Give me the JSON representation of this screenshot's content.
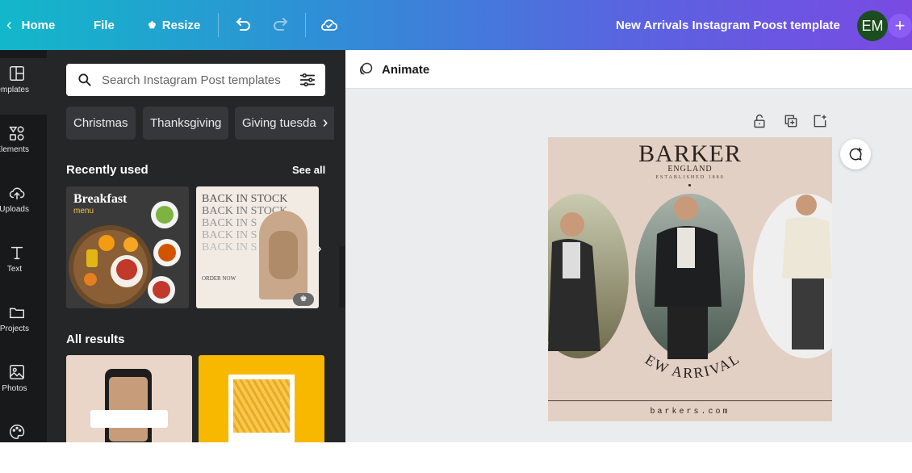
{
  "topbar": {
    "home_label": "Home",
    "file_label": "File",
    "resize_label": "Resize",
    "doc_title": "New Arrivals Instagram Poost template",
    "avatar_initials": "EM",
    "plus_label": "+"
  },
  "rail": {
    "items": [
      {
        "label": "Templates",
        "icon": "templates-icon"
      },
      {
        "label": "Elements",
        "icon": "elements-icon"
      },
      {
        "label": "Uploads",
        "icon": "uploads-icon"
      },
      {
        "label": "Text",
        "icon": "text-icon"
      },
      {
        "label": "Projects",
        "icon": "projects-icon"
      },
      {
        "label": "Photos",
        "icon": "photos-icon"
      },
      {
        "label": "",
        "icon": "palette-icon"
      }
    ]
  },
  "panel": {
    "search_placeholder": "Search Instagram Post templates",
    "chips": [
      "Christmas",
      "Thanksgiving",
      "Giving tuesday"
    ],
    "recently_used_title": "Recently used",
    "see_all_label": "See all",
    "all_results_title": "All results",
    "recent_thumbs": [
      {
        "title": "Breakfast",
        "subtitle": "menu"
      },
      {
        "lines": [
          "BACK IN STOCK",
          "BACK IN STOCK",
          "BACK IN S",
          "BACK IN S",
          "BACK IN S"
        ],
        "cta": "ORDER NOW"
      }
    ]
  },
  "workspace": {
    "animate_label": "Animate",
    "design": {
      "brand": "BARKER",
      "country": "ENGLAND",
      "established": "ESTABLISHED 1880",
      "headline": "NEW ARRIVALS",
      "url": "barkers.com"
    }
  },
  "colors": {
    "rail_bg": "#18191b",
    "panel_bg": "#252627",
    "design_bg": "#e3d0c4",
    "avatar_bg": "#1b4d1f",
    "accent_yellow": "#f9b800"
  }
}
